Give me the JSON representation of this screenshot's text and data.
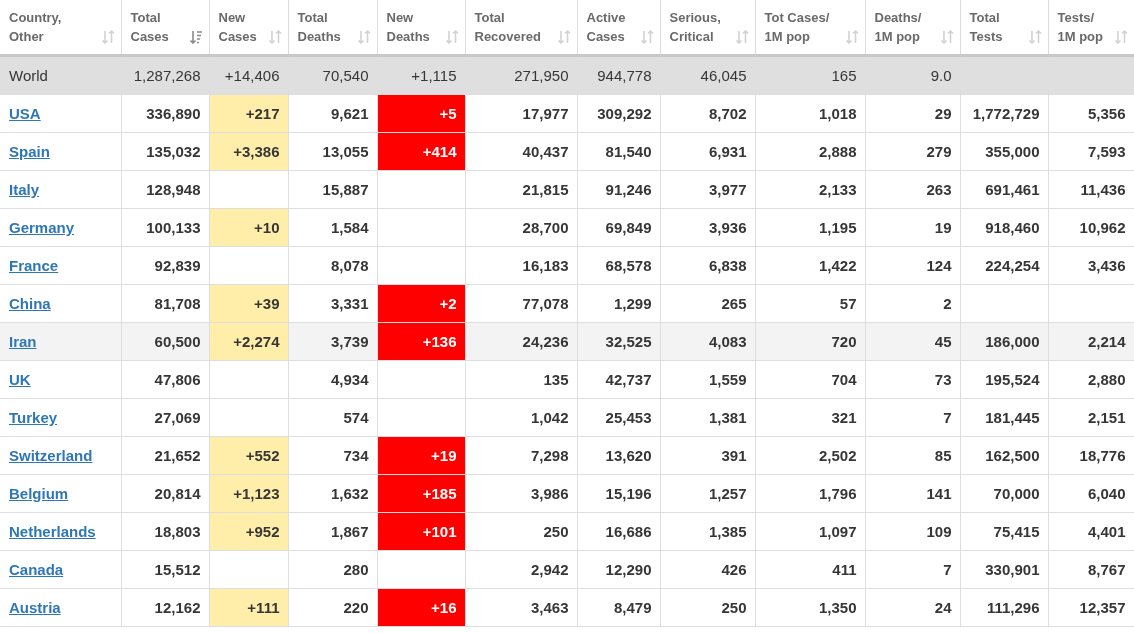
{
  "table": {
    "columns": [
      {
        "label": "Country, Other",
        "sorted": false
      },
      {
        "label": "Total Cases",
        "sorted": true
      },
      {
        "label": "New Cases",
        "sorted": false
      },
      {
        "label": "Total Deaths",
        "sorted": false
      },
      {
        "label": "New Deaths",
        "sorted": false
      },
      {
        "label": "Total Recovered",
        "sorted": false
      },
      {
        "label": "Active Cases",
        "sorted": false
      },
      {
        "label": "Serious, Critical",
        "sorted": false
      },
      {
        "label": "Tot Cases/ 1M pop",
        "sorted": false
      },
      {
        "label": "Deaths/ 1M pop",
        "sorted": false
      },
      {
        "label": "Total Tests",
        "sorted": false
      },
      {
        "label": "Tests/ 1M pop",
        "sorted": false
      }
    ],
    "total_row": {
      "country": "World",
      "total_cases": "1,287,268",
      "new_cases": "+14,406",
      "total_deaths": "70,540",
      "new_deaths": "+1,115",
      "total_recovered": "271,950",
      "active_cases": "944,778",
      "serious": "46,045",
      "cases_per_1m": "165",
      "deaths_per_1m": "9.0"
    },
    "rows": [
      {
        "country": "USA",
        "highlighted": false,
        "total_cases": "336,890",
        "new_cases": "+217",
        "total_deaths": "9,621",
        "new_deaths": "+5",
        "total_recovered": "17,977",
        "active_cases": "309,292",
        "serious": "8,702",
        "cases_per_1m": "1,018",
        "deaths_per_1m": "29",
        "total_tests": "1,772,729",
        "tests_per_1m": "5,356"
      },
      {
        "country": "Spain",
        "highlighted": false,
        "total_cases": "135,032",
        "new_cases": "+3,386",
        "total_deaths": "13,055",
        "new_deaths": "+414",
        "total_recovered": "40,437",
        "active_cases": "81,540",
        "serious": "6,931",
        "cases_per_1m": "2,888",
        "deaths_per_1m": "279",
        "total_tests": "355,000",
        "tests_per_1m": "7,593"
      },
      {
        "country": "Italy",
        "highlighted": false,
        "total_cases": "128,948",
        "total_deaths": "15,887",
        "total_recovered": "21,815",
        "active_cases": "91,246",
        "serious": "3,977",
        "cases_per_1m": "2,133",
        "deaths_per_1m": "263",
        "total_tests": "691,461",
        "tests_per_1m": "11,436"
      },
      {
        "country": "Germany",
        "highlighted": false,
        "total_cases": "100,133",
        "new_cases": "+10",
        "total_deaths": "1,584",
        "total_recovered": "28,700",
        "active_cases": "69,849",
        "serious": "3,936",
        "cases_per_1m": "1,195",
        "deaths_per_1m": "19",
        "total_tests": "918,460",
        "tests_per_1m": "10,962"
      },
      {
        "country": "France",
        "highlighted": false,
        "total_cases": "92,839",
        "total_deaths": "8,078",
        "total_recovered": "16,183",
        "active_cases": "68,578",
        "serious": "6,838",
        "cases_per_1m": "1,422",
        "deaths_per_1m": "124",
        "total_tests": "224,254",
        "tests_per_1m": "3,436"
      },
      {
        "country": "China",
        "highlighted": false,
        "total_cases": "81,708",
        "new_cases": "+39",
        "total_deaths": "3,331",
        "new_deaths": "+2",
        "total_recovered": "77,078",
        "active_cases": "1,299",
        "serious": "265",
        "cases_per_1m": "57",
        "deaths_per_1m": "2"
      },
      {
        "country": "Iran",
        "highlighted": true,
        "total_cases": "60,500",
        "new_cases": "+2,274",
        "total_deaths": "3,739",
        "new_deaths": "+136",
        "total_recovered": "24,236",
        "active_cases": "32,525",
        "serious": "4,083",
        "cases_per_1m": "720",
        "deaths_per_1m": "45",
        "total_tests": "186,000",
        "tests_per_1m": "2,214"
      },
      {
        "country": "UK",
        "highlighted": false,
        "total_cases": "47,806",
        "total_deaths": "4,934",
        "total_recovered": "135",
        "active_cases": "42,737",
        "serious": "1,559",
        "cases_per_1m": "704",
        "deaths_per_1m": "73",
        "total_tests": "195,524",
        "tests_per_1m": "2,880"
      },
      {
        "country": "Turkey",
        "highlighted": false,
        "total_cases": "27,069",
        "total_deaths": "574",
        "total_recovered": "1,042",
        "active_cases": "25,453",
        "serious": "1,381",
        "cases_per_1m": "321",
        "deaths_per_1m": "7",
        "total_tests": "181,445",
        "tests_per_1m": "2,151"
      },
      {
        "country": "Switzerland",
        "highlighted": false,
        "total_cases": "21,652",
        "new_cases": "+552",
        "total_deaths": "734",
        "new_deaths": "+19",
        "total_recovered": "7,298",
        "active_cases": "13,620",
        "serious": "391",
        "cases_per_1m": "2,502",
        "deaths_per_1m": "85",
        "total_tests": "162,500",
        "tests_per_1m": "18,776"
      },
      {
        "country": "Belgium",
        "highlighted": false,
        "total_cases": "20,814",
        "new_cases": "+1,123",
        "total_deaths": "1,632",
        "new_deaths": "+185",
        "total_recovered": "3,986",
        "active_cases": "15,196",
        "serious": "1,257",
        "cases_per_1m": "1,796",
        "deaths_per_1m": "141",
        "total_tests": "70,000",
        "tests_per_1m": "6,040"
      },
      {
        "country": "Netherlands",
        "highlighted": false,
        "total_cases": "18,803",
        "new_cases": "+952",
        "total_deaths": "1,867",
        "new_deaths": "+101",
        "total_recovered": "250",
        "active_cases": "16,686",
        "serious": "1,385",
        "cases_per_1m": "1,097",
        "deaths_per_1m": "109",
        "total_tests": "75,415",
        "tests_per_1m": "4,401"
      },
      {
        "country": "Canada",
        "highlighted": false,
        "total_cases": "15,512",
        "total_deaths": "280",
        "total_recovered": "2,942",
        "active_cases": "12,290",
        "serious": "426",
        "cases_per_1m": "411",
        "deaths_per_1m": "7",
        "total_tests": "330,901",
        "tests_per_1m": "8,767"
      },
      {
        "country": "Austria",
        "highlighted": false,
        "total_cases": "12,162",
        "new_cases": "+111",
        "total_deaths": "220",
        "new_deaths": "+16",
        "total_recovered": "3,463",
        "active_cases": "8,479",
        "serious": "250",
        "cases_per_1m": "1,350",
        "deaths_per_1m": "24",
        "total_tests": "111,296",
        "tests_per_1m": "12,357"
      }
    ]
  }
}
